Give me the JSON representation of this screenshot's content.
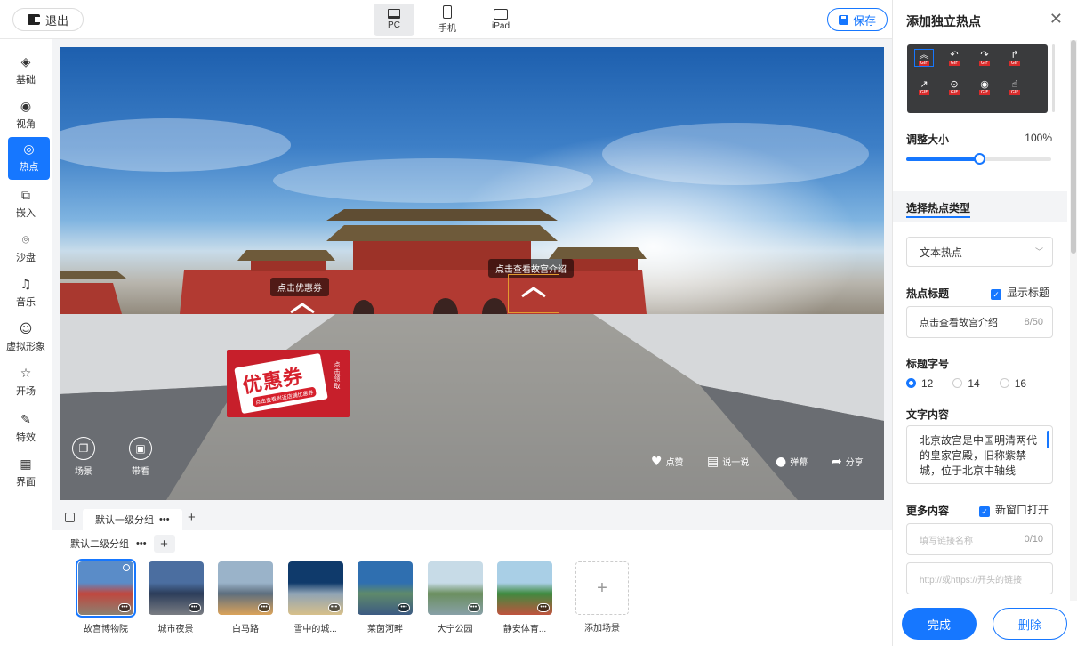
{
  "topbar": {
    "exit_label": "退出",
    "devices": [
      {
        "label": "PC",
        "icon": "monitor-icon",
        "active": true
      },
      {
        "label": "手机",
        "icon": "phone-icon",
        "active": false
      },
      {
        "label": "iPad",
        "icon": "tablet-icon",
        "active": false
      }
    ],
    "save_label": "保存"
  },
  "sidebar": {
    "items": [
      {
        "label": "基础",
        "icon": "layers-icon"
      },
      {
        "label": "视角",
        "icon": "eye-icon"
      },
      {
        "label": "热点",
        "icon": "hotspot-icon",
        "active": true
      },
      {
        "label": "嵌入",
        "icon": "embed-icon"
      },
      {
        "label": "沙盘",
        "icon": "map-pin-icon"
      },
      {
        "label": "音乐",
        "icon": "music-icon"
      },
      {
        "label": "虚拟形象",
        "icon": "smiley-icon"
      },
      {
        "label": "开场",
        "icon": "star-icon"
      },
      {
        "label": "特效",
        "icon": "magic-icon"
      },
      {
        "label": "界面",
        "icon": "grid-icon"
      }
    ]
  },
  "viewport": {
    "hotspot_coupon_label": "点击优惠券",
    "hotspot_intro_label": "点击查看故宫介绍",
    "coupon": {
      "title": "优惠券",
      "subtitle": "点击查看附近店铺优惠券",
      "side": "点击领取"
    },
    "bottom_left": [
      {
        "label": "场景",
        "icon": "scenes-icon"
      },
      {
        "label": "带看",
        "icon": "guide-icon"
      }
    ],
    "actions": [
      {
        "label": "点赞",
        "icon": "heart-icon"
      },
      {
        "label": "说一说",
        "icon": "comment-icon"
      },
      {
        "label": "弹幕",
        "icon": "danmaku-icon"
      },
      {
        "label": "分享",
        "icon": "share-icon"
      }
    ]
  },
  "scenes": {
    "group1": "默认一级分组",
    "group2": "默认二级分组",
    "more": "•••",
    "add_label": "添加场景",
    "items": [
      {
        "name": "故宫博物院",
        "colors": [
          "#5a8cc8",
          "#c0473e",
          "#8a8272"
        ],
        "active": true
      },
      {
        "name": "城市夜景",
        "colors": [
          "#4b6ea0",
          "#2c3d5a",
          "#7a7d83"
        ]
      },
      {
        "name": "白马路",
        "colors": [
          "#9ab3c9",
          "#5d6e7e",
          "#dba35a"
        ]
      },
      {
        "name": "雪中的城...",
        "colors": [
          "#0f3a6b",
          "#8fa3b5",
          "#d8c08a"
        ]
      },
      {
        "name": "莱茵河畔",
        "colors": [
          "#2f6fb0",
          "#5f8a6a",
          "#3c5a82"
        ]
      },
      {
        "name": "大宁公园",
        "colors": [
          "#c7dbe7",
          "#6b8f5f",
          "#88a0a8"
        ]
      },
      {
        "name": "静安体育...",
        "colors": [
          "#a9cfe6",
          "#3f8a3f",
          "#c0533e"
        ]
      }
    ]
  },
  "panel": {
    "title": "添加独立热点",
    "size_label": "调整大小",
    "size_value": "100%",
    "size_fraction": 0.5,
    "type_section": "选择热点类型",
    "type_value": "文本热点",
    "hotspot_title_label": "热点标题",
    "show_title_label": "显示标题",
    "hotspot_title_value": "点击查看故宫介绍",
    "hotspot_title_count": "8/50",
    "font_size_label": "标题字号",
    "font_sizes": [
      "12",
      "14",
      "16"
    ],
    "font_size_selected": "12",
    "text_content_label": "文字内容",
    "text_content_value": "北京故宫是中国明清两代的皇家宫殿，旧称紫禁城，位于北京中轴线",
    "more_label": "更多内容",
    "new_window_label": "新窗口打开",
    "link_name_placeholder": "填写链接名称",
    "link_name_count": "0/10",
    "link_url_placeholder": "http://或https://开头的链接",
    "done_label": "完成",
    "delete_label": "删除",
    "gif_tag": "GIF"
  }
}
